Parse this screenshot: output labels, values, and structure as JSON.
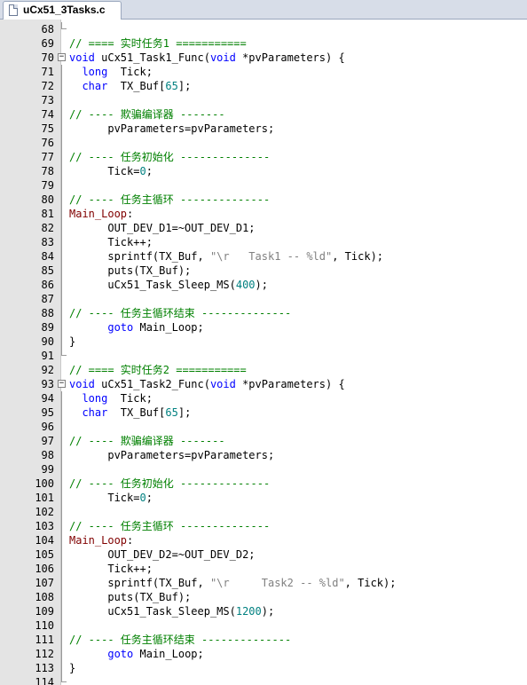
{
  "tab": {
    "title": "uCx51_3Tasks.c"
  },
  "colors": {
    "comment": "#008000",
    "keyword": "#0000ff",
    "label": "#800000",
    "number": "#008080",
    "string": "#808080",
    "gutter": "#e4e4e4"
  },
  "lines": [
    {
      "n": "68",
      "fold": "end",
      "tokens": []
    },
    {
      "n": "69",
      "tokens": [
        {
          "t": "// ==== 实时任务1 ===========",
          "c": "cm"
        }
      ]
    },
    {
      "n": "70",
      "fold": "open",
      "tokens": [
        {
          "t": "void",
          "c": "kw"
        },
        {
          "t": " uCx51_Task1_Func("
        },
        {
          "t": "void",
          "c": "kw"
        },
        {
          "t": " *pvParameters) {"
        }
      ]
    },
    {
      "n": "71",
      "fold": "line",
      "tokens": [
        {
          "t": "  "
        },
        {
          "t": "long",
          "c": "kw"
        },
        {
          "t": "  Tick;"
        }
      ]
    },
    {
      "n": "72",
      "fold": "line",
      "tokens": [
        {
          "t": "  "
        },
        {
          "t": "char",
          "c": "kw"
        },
        {
          "t": "  TX_Buf["
        },
        {
          "t": "65",
          "c": "num"
        },
        {
          "t": "];"
        }
      ]
    },
    {
      "n": "73",
      "fold": "line",
      "tokens": []
    },
    {
      "n": "74",
      "fold": "line",
      "tokens": [
        {
          "t": "// ---- 欺骗编译器 -------",
          "c": "cm"
        }
      ]
    },
    {
      "n": "75",
      "fold": "line",
      "tokens": [
        {
          "t": "      pvParameters=pvParameters;"
        }
      ]
    },
    {
      "n": "76",
      "fold": "line",
      "tokens": []
    },
    {
      "n": "77",
      "fold": "line",
      "tokens": [
        {
          "t": "// ---- 任务初始化 --------------",
          "c": "cm"
        }
      ]
    },
    {
      "n": "78",
      "fold": "line",
      "tokens": [
        {
          "t": "      Tick="
        },
        {
          "t": "0",
          "c": "num"
        },
        {
          "t": ";"
        }
      ]
    },
    {
      "n": "79",
      "fold": "line",
      "tokens": []
    },
    {
      "n": "80",
      "fold": "line",
      "tokens": [
        {
          "t": "// ---- 任务主循环 --------------",
          "c": "cm"
        }
      ]
    },
    {
      "n": "81",
      "fold": "line",
      "tokens": [
        {
          "t": "Main_Loop",
          "c": "lb"
        },
        {
          "t": ":"
        }
      ]
    },
    {
      "n": "82",
      "fold": "line",
      "tokens": [
        {
          "t": "      OUT_DEV_D1=~OUT_DEV_D1;"
        }
      ]
    },
    {
      "n": "83",
      "fold": "line",
      "tokens": [
        {
          "t": "      Tick++;"
        }
      ]
    },
    {
      "n": "84",
      "fold": "line",
      "tokens": [
        {
          "t": "      sprintf(TX_Buf, "
        },
        {
          "t": "\"\\r   Task1 -- %ld\"",
          "c": "str"
        },
        {
          "t": ", Tick);"
        }
      ]
    },
    {
      "n": "85",
      "fold": "line",
      "tokens": [
        {
          "t": "      puts(TX_Buf);"
        }
      ]
    },
    {
      "n": "86",
      "fold": "line",
      "tokens": [
        {
          "t": "      uCx51_Task_Sleep_MS("
        },
        {
          "t": "400",
          "c": "num"
        },
        {
          "t": ");"
        }
      ]
    },
    {
      "n": "87",
      "fold": "line",
      "tokens": []
    },
    {
      "n": "88",
      "fold": "line",
      "tokens": [
        {
          "t": "// ---- 任务主循环结束 --------------",
          "c": "cm"
        }
      ]
    },
    {
      "n": "89",
      "fold": "line",
      "tokens": [
        {
          "t": "      "
        },
        {
          "t": "goto",
          "c": "kw"
        },
        {
          "t": " Main_Loop;"
        }
      ]
    },
    {
      "n": "90",
      "fold": "line",
      "tokens": [
        {
          "t": "}"
        }
      ]
    },
    {
      "n": "91",
      "fold": "end",
      "tokens": []
    },
    {
      "n": "92",
      "tokens": [
        {
          "t": "// ==== 实时任务2 ===========",
          "c": "cm"
        }
      ]
    },
    {
      "n": "93",
      "fold": "open",
      "tokens": [
        {
          "t": "void",
          "c": "kw"
        },
        {
          "t": " uCx51_Task2_Func("
        },
        {
          "t": "void",
          "c": "kw"
        },
        {
          "t": " *pvParameters) {"
        }
      ]
    },
    {
      "n": "94",
      "fold": "line",
      "tokens": [
        {
          "t": "  "
        },
        {
          "t": "long",
          "c": "kw"
        },
        {
          "t": "  Tick;"
        }
      ]
    },
    {
      "n": "95",
      "fold": "line",
      "tokens": [
        {
          "t": "  "
        },
        {
          "t": "char",
          "c": "kw"
        },
        {
          "t": "  TX_Buf["
        },
        {
          "t": "65",
          "c": "num"
        },
        {
          "t": "];"
        }
      ]
    },
    {
      "n": "96",
      "fold": "line",
      "tokens": []
    },
    {
      "n": "97",
      "fold": "line",
      "tokens": [
        {
          "t": "// ---- 欺骗编译器 -------",
          "c": "cm"
        }
      ]
    },
    {
      "n": "98",
      "fold": "line",
      "tokens": [
        {
          "t": "      pvParameters=pvParameters;"
        }
      ]
    },
    {
      "n": "99",
      "fold": "line",
      "tokens": []
    },
    {
      "n": "100",
      "fold": "line",
      "tokens": [
        {
          "t": "// ---- 任务初始化 --------------",
          "c": "cm"
        }
      ]
    },
    {
      "n": "101",
      "fold": "line",
      "tokens": [
        {
          "t": "      Tick="
        },
        {
          "t": "0",
          "c": "num"
        },
        {
          "t": ";"
        }
      ]
    },
    {
      "n": "102",
      "fold": "line",
      "tokens": []
    },
    {
      "n": "103",
      "fold": "line",
      "tokens": [
        {
          "t": "// ---- 任务主循环 --------------",
          "c": "cm"
        }
      ]
    },
    {
      "n": "104",
      "fold": "line",
      "tokens": [
        {
          "t": "Main_Loop",
          "c": "lb"
        },
        {
          "t": ":"
        }
      ]
    },
    {
      "n": "105",
      "fold": "line",
      "tokens": [
        {
          "t": "      OUT_DEV_D2=~OUT_DEV_D2;"
        }
      ]
    },
    {
      "n": "106",
      "fold": "line",
      "tokens": [
        {
          "t": "      Tick++;"
        }
      ]
    },
    {
      "n": "107",
      "fold": "line",
      "tokens": [
        {
          "t": "      sprintf(TX_Buf, "
        },
        {
          "t": "\"\\r     Task2 -- %ld\"",
          "c": "str"
        },
        {
          "t": ", Tick);"
        }
      ]
    },
    {
      "n": "108",
      "fold": "line",
      "tokens": [
        {
          "t": "      puts(TX_Buf);"
        }
      ]
    },
    {
      "n": "109",
      "fold": "line",
      "tokens": [
        {
          "t": "      uCx51_Task_Sleep_MS("
        },
        {
          "t": "1200",
          "c": "num"
        },
        {
          "t": ");"
        }
      ]
    },
    {
      "n": "110",
      "fold": "line",
      "tokens": []
    },
    {
      "n": "111",
      "fold": "line",
      "tokens": [
        {
          "t": "// ---- 任务主循环结束 --------------",
          "c": "cm"
        }
      ]
    },
    {
      "n": "112",
      "fold": "line",
      "tokens": [
        {
          "t": "      "
        },
        {
          "t": "goto",
          "c": "kw"
        },
        {
          "t": " Main_Loop;"
        }
      ]
    },
    {
      "n": "113",
      "fold": "line",
      "tokens": [
        {
          "t": "}"
        }
      ]
    },
    {
      "n": "114",
      "fold": "end",
      "tokens": []
    }
  ]
}
